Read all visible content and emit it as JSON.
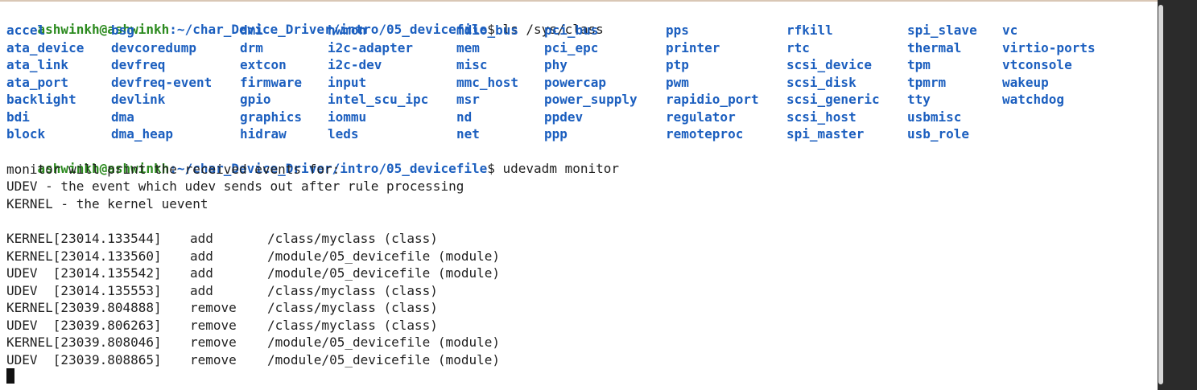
{
  "terminal": {
    "prompt_user": "ashwinkh@ashwinkh",
    "prompt_path": ":~/char_Device_Driver/intro/05_devicefile",
    "command1": "$ ls /sys/class",
    "command2": "$ udevadm monitor",
    "ls_columns": [
      [
        "accel",
        "ata_device",
        "ata_link",
        "ata_port",
        "backlight",
        "bdi",
        "block"
      ],
      [
        "bsg",
        "devcoredump",
        "devfreq",
        "devfreq-event",
        "devlink",
        "dma",
        "dma_heap"
      ],
      [
        "dmi",
        "drm",
        "extcon",
        "firmware",
        "gpio",
        "graphics",
        "hidraw"
      ],
      [
        "hwmon",
        "i2c-adapter",
        "i2c-dev",
        "input",
        "intel_scu_ipc",
        "iommu",
        "leds"
      ],
      [
        "mdio_bus",
        "mem",
        "misc",
        "mmc_host",
        "msr",
        "nd",
        "net"
      ],
      [
        "pci_bus",
        "pci_epc",
        "phy",
        "powercap",
        "power_supply",
        "ppdev",
        "ppp"
      ],
      [
        "pps",
        "printer",
        "ptp",
        "pwm",
        "rapidio_port",
        "regulator",
        "remoteproc"
      ],
      [
        "rfkill",
        "rtc",
        "scsi_device",
        "scsi_disk",
        "scsi_generic",
        "scsi_host",
        "spi_master"
      ],
      [
        "spi_slave",
        "thermal",
        "tpm",
        "tpmrm",
        "tty",
        "usbmisc",
        "usb_role"
      ],
      [
        "vc",
        "virtio-ports",
        "vtconsole",
        "wakeup",
        "watchdog",
        "",
        ""
      ]
    ],
    "monitor_lines": [
      "monitor will print the received events for:",
      "UDEV - the event which udev sends out after rule processing",
      "KERNEL - the kernel uevent"
    ],
    "events": [
      {
        "type": "KERNEL[23014.133544]",
        "action": "add",
        "path": "/class/myclass (class)"
      },
      {
        "type": "KERNEL[23014.133560]",
        "action": "add",
        "path": "/module/05_devicefile (module)"
      },
      {
        "type": "UDEV  [23014.135542]",
        "action": "add",
        "path": "/module/05_devicefile (module)"
      },
      {
        "type": "UDEV  [23014.135553]",
        "action": "add",
        "path": "/class/myclass (class)"
      },
      {
        "type": "KERNEL[23039.804888]",
        "action": "remove",
        "path": "/class/myclass (class)"
      },
      {
        "type": "UDEV  [23039.806263]",
        "action": "remove",
        "path": "/class/myclass (class)"
      },
      {
        "type": "KERNEL[23039.808046]",
        "action": "remove",
        "path": "/module/05_devicefile (module)"
      },
      {
        "type": "UDEV  [23039.808865]",
        "action": "remove",
        "path": "/module/05_devicefile (module)"
      }
    ]
  },
  "colors": {
    "prompt_user": "#2b8a1e",
    "prompt_path": "#1c5fbf",
    "directory": "#1c5fbf",
    "background": "#ffffff",
    "scrollbar": "#2b2b2b"
  }
}
